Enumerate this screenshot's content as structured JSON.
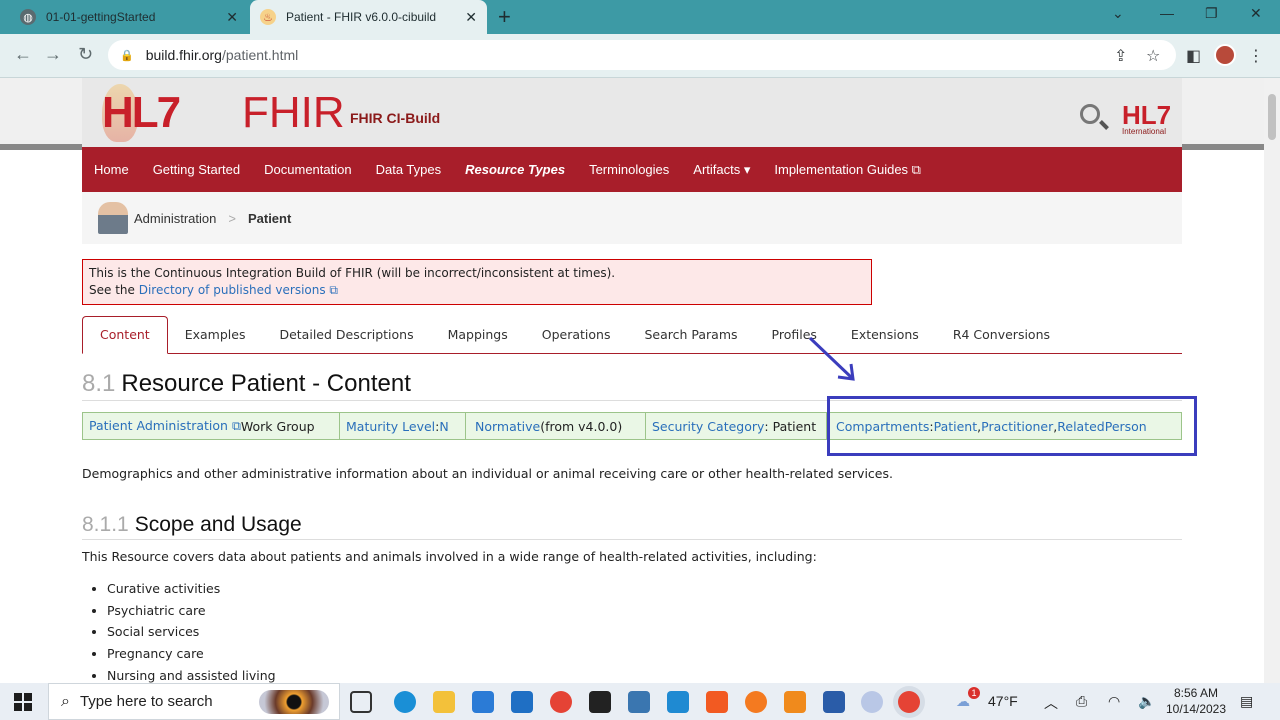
{
  "browser": {
    "tabs": [
      {
        "title": "01-01-gettingStarted",
        "active": false
      },
      {
        "title": "Patient - FHIR v6.0.0-cibuild",
        "active": true
      }
    ],
    "url_host": "build.fhir.org",
    "url_path": "/patient.html"
  },
  "site": {
    "logo_hl7": "HL7",
    "logo_fhir": "FHIR",
    "ci_build": "FHIR CI-Build",
    "hl7_intl": "HL7",
    "hl7_intl_sub": "International"
  },
  "nav": [
    "Home",
    "Getting Started",
    "Documentation",
    "Data Types",
    "Resource Types",
    "Terminologies",
    "Artifacts ▾",
    "Implementation Guides ⧉"
  ],
  "breadcrumb": {
    "parent": "Administration",
    "sep": ">",
    "current": "Patient"
  },
  "notice": {
    "line1": "This is the Continuous Integration Build of FHIR (will be incorrect/inconsistent at times).",
    "line2_prefix": "See the ",
    "line2_link": "Directory of published versions ⧉"
  },
  "tabs": [
    "Content",
    "Examples",
    "Detailed Descriptions",
    "Mappings",
    "Operations",
    "Search Params",
    "Profiles",
    "Extensions",
    "R4 Conversions"
  ],
  "heading1": {
    "num": "8.1",
    "text": "Resource Patient - Content"
  },
  "info": {
    "wg_link": "Patient Administration ⧉",
    "wg_text": " Work Group",
    "maturity_link": "Maturity Level",
    "maturity_sep": ": ",
    "maturity_value": "N",
    "normative_link": "Normative",
    "normative_text": " (from v4.0.0)",
    "security_link": "Security Category",
    "security_text": ": Patient",
    "compartments_link": "Compartments",
    "compartments_sep": ": ",
    "compartments": [
      "Patient",
      "Practitioner",
      "RelatedPerson"
    ],
    "comma": ", "
  },
  "description": "Demographics and other administrative information about an individual or animal receiving care or other health-related services.",
  "heading2": {
    "num": "8.1.1",
    "text": "Scope and Usage"
  },
  "scope_para": "This Resource covers data about patients and animals involved in a wide range of health-related activities, including:",
  "scope_list": [
    "Curative activities",
    "Psychiatric care",
    "Social services",
    "Pregnancy care",
    "Nursing and assisted living"
  ],
  "taskbar": {
    "search_placeholder": "Type here to search",
    "weather": "47°F",
    "weather_badge": "1",
    "time": "8:56 AM",
    "date": "10/14/2023"
  },
  "colors": {
    "brand_red": "#a81e2a",
    "link": "#2a6fbb",
    "annotation": "#3b3dbd"
  }
}
